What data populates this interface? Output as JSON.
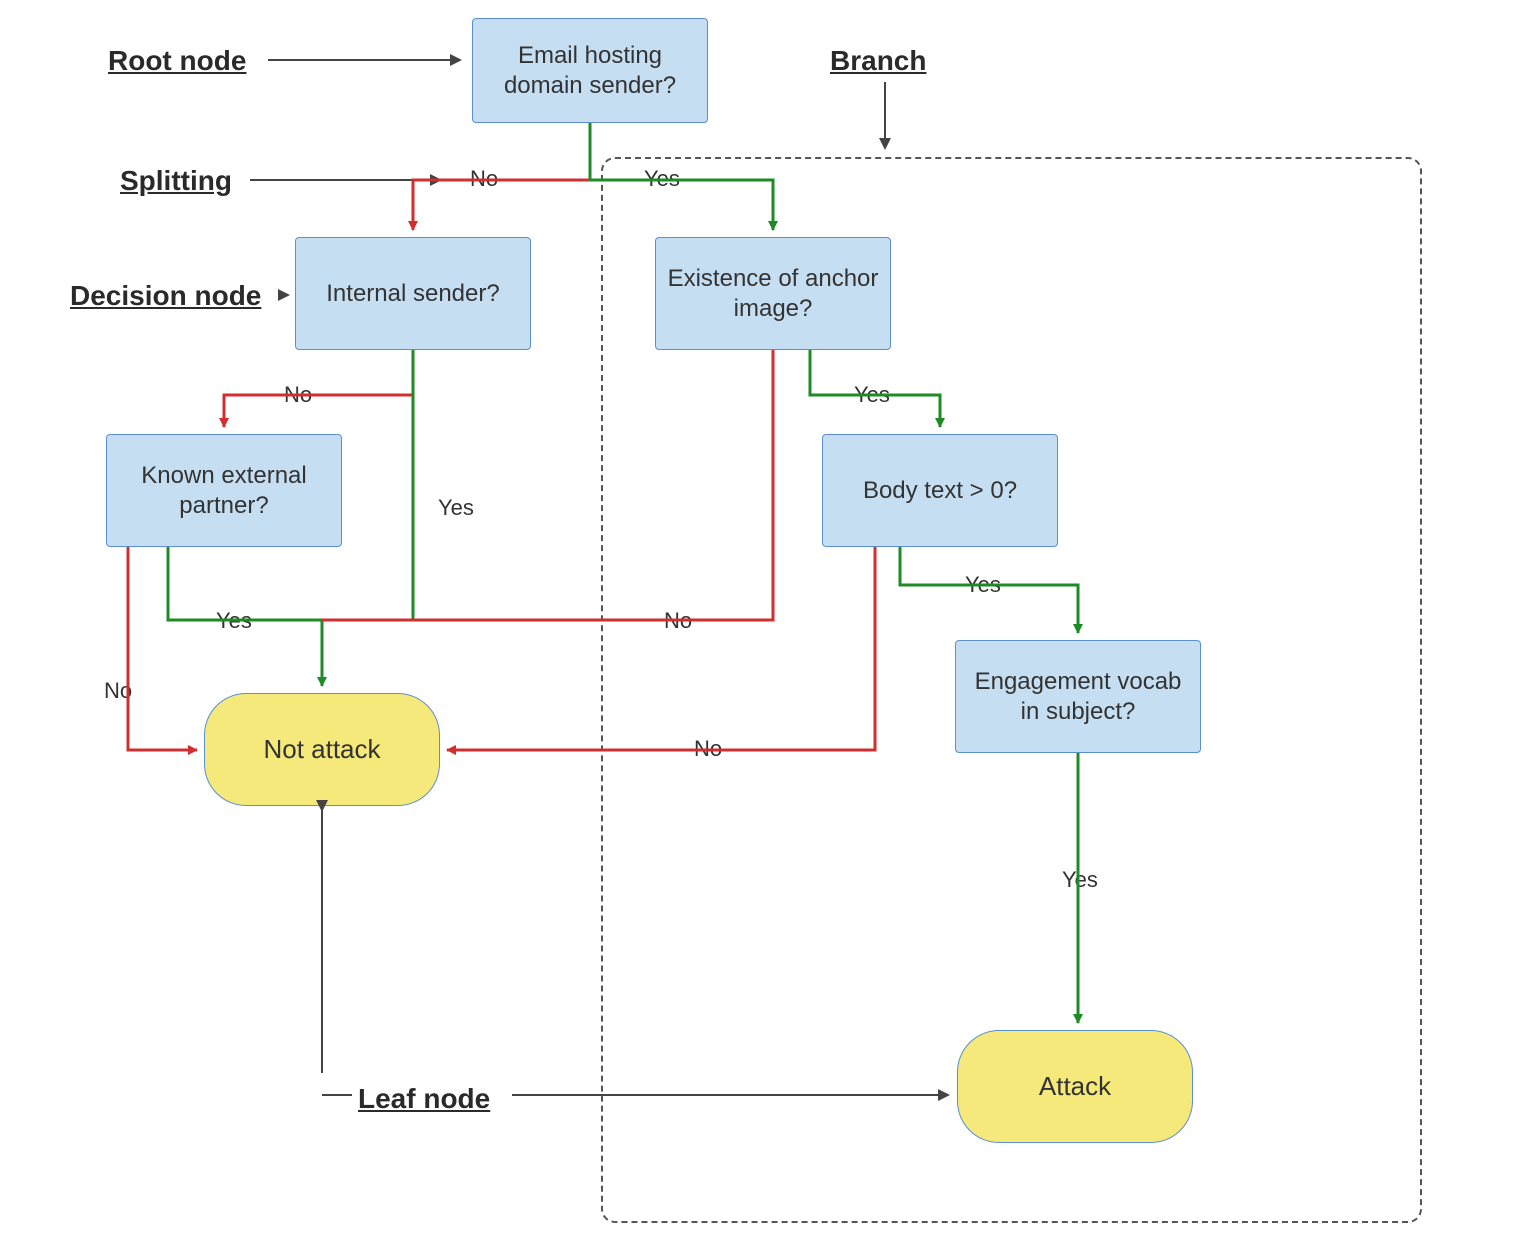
{
  "annotations": {
    "root": "Root node",
    "splitting": "Splitting",
    "decision": "Decision node",
    "leaf": "Leaf node",
    "branch": "Branch"
  },
  "nodes": {
    "root": "Email hosting domain sender?",
    "internal_sender": "Internal sender?",
    "anchor_image": "Existence of anchor image?",
    "known_partner": "Known external partner?",
    "body_text": "Body text > 0?",
    "engagement": "Engagement vocab in subject?"
  },
  "leaves": {
    "not_attack": "Not attack",
    "attack": "Attack"
  },
  "edges": {
    "root_no": "No",
    "root_yes": "Yes",
    "internal_no": "No",
    "internal_yes": "Yes",
    "anchor_no": "No",
    "anchor_yes": "Yes",
    "partner_no": "No",
    "partner_yes": "Yes",
    "body_no": "No",
    "body_yes": "Yes",
    "engagement_yes": "Yes"
  },
  "colors": {
    "no": "#d12f2f",
    "yes": "#1f8b24",
    "annot_arrow": "#444444",
    "node_fill": "#c6def2",
    "node_border": "#5b8fce",
    "leaf_fill": "#f5e97c"
  }
}
